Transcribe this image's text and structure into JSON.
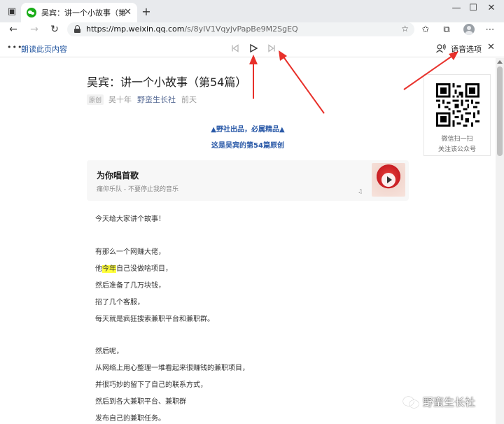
{
  "browser": {
    "tab_title": "吴宾：讲一个小故事（第54篇）",
    "url_host": "https://mp.weixin.qq.com",
    "url_path": "/s/8yIV1VqyjvPapBe9M2SgEQ"
  },
  "reader_toolbar": {
    "read_label": "朗读此页内容",
    "voice_options_label": "语音选项"
  },
  "article": {
    "title": "吴宾：讲一个小故事（第54篇）",
    "badge": "原创",
    "author": "吴十年",
    "account": "野蛮生长社",
    "date": "前天",
    "banner_line1": "▲野社出品，必属精品▲",
    "banner_line2": "这是吴宾的第54篇原创",
    "music": {
      "title": "为你唱首歌",
      "subtitle": "痛仰乐队 - 不要停止我的音乐"
    },
    "paragraphs": {
      "p1": "今天给大家讲个故事！",
      "p2": "有那么一个网赚大佬，",
      "p3_pre": "他",
      "p3_hl": "今年",
      "p3_post": "自己没做啥项目，",
      "p4": "然后准备了几万块钱，",
      "p5": "招了几个客服，",
      "p6": "每天就是疯狂搜索兼职平台和兼职群。",
      "p7": "然后呢，",
      "p8": "从网络上用心整理一堆看起来很赚钱的兼职项目，",
      "p9": "并很巧妙的留下了自己的联系方式，",
      "p10": "然后到各大兼职平台、兼职群",
      "p11": "发布自己的兼职任务。"
    }
  },
  "qr_panel": {
    "caption_line1": "微信扫一扫",
    "caption_line2": "关注该公众号"
  },
  "watermark": "野蛮生长社",
  "colors": {
    "link": "#576b95",
    "banner": "#2b5aa8",
    "highlight": "#ffff3c",
    "annotation_arrow": "#e8302a"
  }
}
